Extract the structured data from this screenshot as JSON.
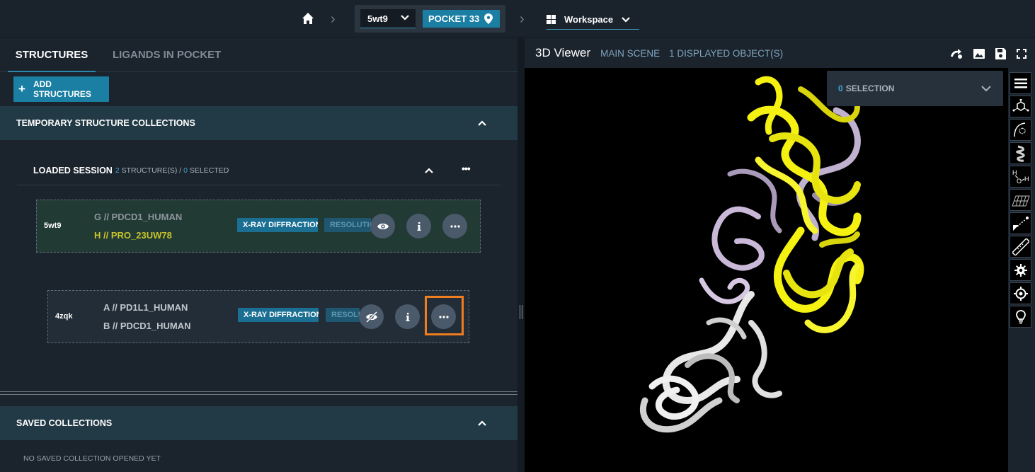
{
  "topbar": {
    "structure_select": "5wt9",
    "pocket_label": "POCKET 33",
    "workspace_label": "Workspace"
  },
  "left": {
    "tabs": [
      {
        "label": "STRUCTURES",
        "active": true
      },
      {
        "label": "LIGANDS IN POCKET",
        "active": false
      }
    ],
    "add_button": "ADD STRUCTURES",
    "temporary_header": "TEMPORARY STRUCTURE COLLECTIONS",
    "loaded_session": {
      "title": "LOADED SESSION",
      "count": "2",
      "count_suffix": "STRUCTURE(S) /",
      "selected": "0",
      "selected_suffix": "SELECTED"
    },
    "structures": [
      {
        "pdb": "5wt9",
        "chain1": "G // PDCD1_HUMAN",
        "chain2": "H // PRO_23UW78",
        "method": "X-RAY DIFFRACTION",
        "resolution": "RESOLUTION",
        "visible": true
      },
      {
        "pdb": "4zqk",
        "chain1": "A // PD1L1_HUMAN",
        "chain2": "B // PDCD1_HUMAN",
        "method": "X-RAY DIFFRACTION",
        "resolution": "RESOLUTION",
        "visible": false
      }
    ],
    "saved_header": "SAVED COLLECTIONS",
    "no_saved": "NO SAVED COLLECTION OPENED YET"
  },
  "viewer": {
    "title": "3D Viewer",
    "scene": "MAIN SCENE",
    "objects": "1 DISPLAYED OBJECT(S)",
    "selection_count": "0",
    "selection_label": "SELECTION",
    "tools": [
      "menu-icon",
      "molecule-icon",
      "surface-icon",
      "helix-icon",
      "water-icon",
      "grid-icon",
      "distance-icon",
      "ruler-icon",
      "settings-icon",
      "target-icon",
      "bulb-icon"
    ]
  },
  "colors": {
    "accent": "#1a7fa3",
    "highlight": "#f07d1e",
    "chain_yellow": "#f5f212",
    "chain_lavender": "#c9b8d8",
    "chain_white": "#e8e8e8"
  }
}
